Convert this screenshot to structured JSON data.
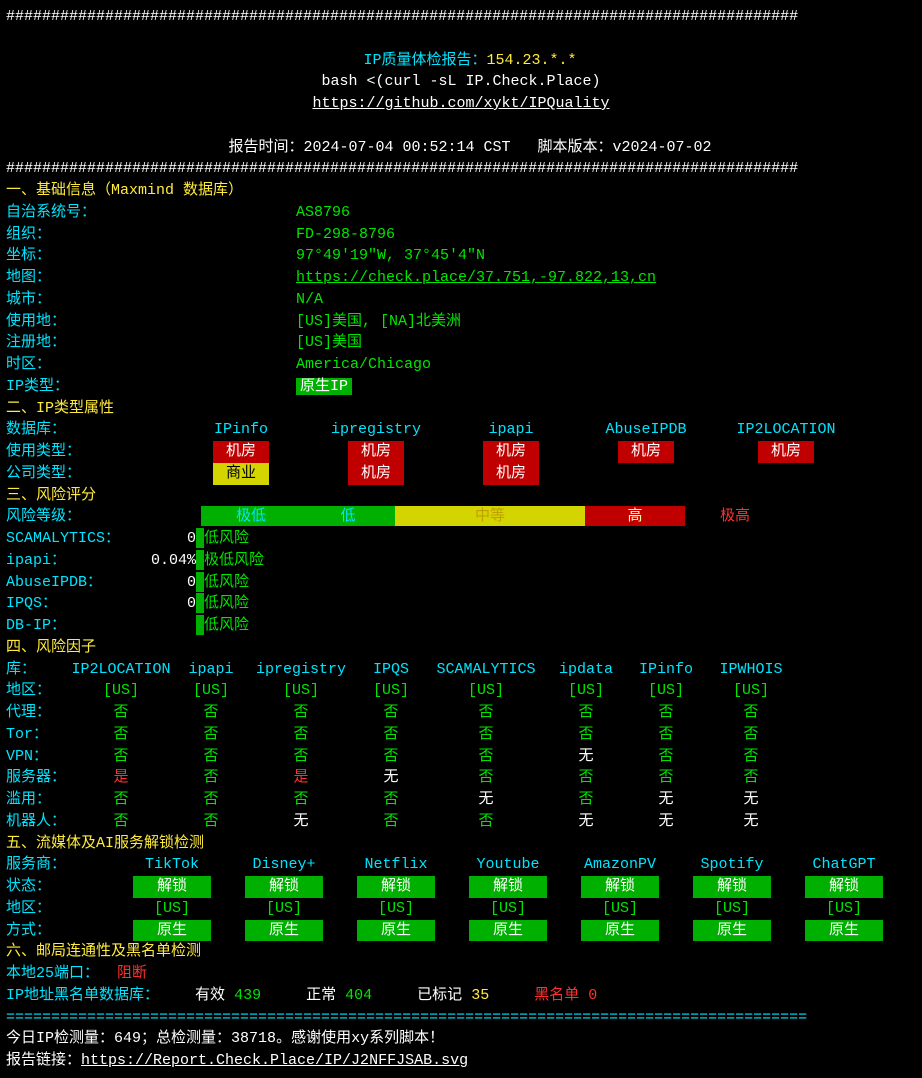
{
  "title": "IP质量体检报告：",
  "ip": "154.23.*.*",
  "cmd": "bash <(curl -sL IP.Check.Place)",
  "github": "https://github.com/xykt/IPQuality",
  "report_time_label": "报告时间：",
  "report_time": "2024-07-04 00:52:14 CST",
  "script_ver_label": "脚本版本：",
  "script_ver": "v2024-07-02",
  "sec1": "一、基础信息（Maxmind 数据库）",
  "basic": {
    "asn_l": "自治系统号：",
    "asn": "AS8796",
    "org_l": "组织：",
    "org": "FD-298-8796",
    "coord_l": "坐标：",
    "coord": "97°49′19″W, 37°45′4″N",
    "map_l": "地图：",
    "map": "https://check.place/37.751,-97.822,13,cn",
    "city_l": "城市：",
    "city": "N/A",
    "use_l": "使用地：",
    "use": "[US]美国, [NA]北美洲",
    "reg_l": "注册地：",
    "reg": "[US]美国",
    "tz_l": "时区：",
    "tz": "America/Chicago",
    "iptype_l": "IP类型：",
    "iptype": "原生IP"
  },
  "sec2": "二、IP类型属性",
  "db_l": "数据库：",
  "db_cols": [
    "IPinfo",
    "ipregistry",
    "ipapi",
    "AbuseIPDB",
    "IP2LOCATION"
  ],
  "usage_l": "使用类型：",
  "usage_vals": [
    "机房",
    "机房",
    "机房",
    "机房",
    "机房"
  ],
  "company_l": "公司类型：",
  "company_vals": [
    "商业",
    "机房",
    "机房",
    "",
    ""
  ],
  "sec3": "三、风险评分",
  "risk_level_l": "风险等级：",
  "risk_levels": [
    "极低",
    "低",
    "中等",
    "高",
    "极高"
  ],
  "risk_rows": [
    {
      "name": "SCAMALYTICS：",
      "score": "0",
      "label": "低风险"
    },
    {
      "name": "ipapi：",
      "score": "0.04%",
      "label": "极低风险"
    },
    {
      "name": "AbuseIPDB：",
      "score": "0",
      "label": "低风险"
    },
    {
      "name": "IPQS：",
      "score": "0",
      "label": "低风险"
    },
    {
      "name": "DB-IP：",
      "score": "",
      "label": "低风险"
    }
  ],
  "sec4": "四、风险因子",
  "factor_lib_l": "库：",
  "factor_cols": [
    "IP2LOCATION",
    "ipapi",
    "ipregistry",
    "IPQS",
    "SCAMALYTICS",
    "ipdata",
    "IPinfo",
    "IPWHOIS"
  ],
  "factor_rows": [
    {
      "l": "地区：",
      "color": "green",
      "v": [
        "[US]",
        "[US]",
        "[US]",
        "[US]",
        "[US]",
        "[US]",
        "[US]",
        "[US]"
      ]
    },
    {
      "l": "代理：",
      "v": [
        "否",
        "否",
        "否",
        "否",
        "否",
        "否",
        "否",
        "否"
      ],
      "colors": [
        "g",
        "g",
        "g",
        "g",
        "g",
        "g",
        "g",
        "g"
      ]
    },
    {
      "l": "Tor：",
      "v": [
        "否",
        "否",
        "否",
        "否",
        "否",
        "否",
        "否",
        "否"
      ],
      "colors": [
        "g",
        "g",
        "g",
        "g",
        "g",
        "g",
        "g",
        "g"
      ]
    },
    {
      "l": "VPN：",
      "v": [
        "否",
        "否",
        "否",
        "否",
        "否",
        "无",
        "否",
        "否"
      ],
      "colors": [
        "g",
        "g",
        "g",
        "g",
        "g",
        "w",
        "g",
        "g"
      ]
    },
    {
      "l": "服务器：",
      "v": [
        "是",
        "否",
        "是",
        "无",
        "否",
        "否",
        "否",
        "否"
      ],
      "colors": [
        "r",
        "g",
        "r",
        "w",
        "g",
        "g",
        "g",
        "g"
      ]
    },
    {
      "l": "滥用：",
      "v": [
        "否",
        "否",
        "否",
        "否",
        "无",
        "否",
        "无",
        "无"
      ],
      "colors": [
        "g",
        "g",
        "g",
        "g",
        "w",
        "g",
        "w",
        "w"
      ]
    },
    {
      "l": "机器人：",
      "v": [
        "否",
        "否",
        "无",
        "否",
        "否",
        "无",
        "无",
        "无"
      ],
      "colors": [
        "g",
        "g",
        "w",
        "g",
        "g",
        "w",
        "w",
        "w"
      ]
    }
  ],
  "sec5": "五、流媒体及AI服务解锁检测",
  "svc_l": "服务商：",
  "svc_cols": [
    "TikTok",
    "Disney+",
    "Netflix",
    "Youtube",
    "AmazonPV",
    "Spotify",
    "ChatGPT"
  ],
  "status_l": "状态：",
  "status_vals": [
    "解锁",
    "解锁",
    "解锁",
    "解锁",
    "解锁",
    "解锁",
    "解锁"
  ],
  "region_l": "地区：",
  "region_vals": [
    "[US]",
    "[US]",
    "[US]",
    "[US]",
    "[US]",
    "[US]",
    "[US]"
  ],
  "method_l": "方式：",
  "method_vals": [
    "原生",
    "原生",
    "原生",
    "原生",
    "原生",
    "原生",
    "原生"
  ],
  "sec6": "六、邮局连通性及黑名单检测",
  "port_l": "本地25端口：",
  "port_v": "阻断",
  "bl_l": "IP地址黑名单数据库：",
  "bl_valid_l": "有效",
  "bl_valid": "439",
  "bl_ok_l": "正常",
  "bl_ok": "404",
  "bl_marked_l": "已标记",
  "bl_marked": "35",
  "bl_black_l": "黑名单",
  "bl_black": "0",
  "footer1a": "今日IP检测量：",
  "footer1b": "649",
  "footer1c": "；总检测量：",
  "footer1d": "38718",
  "footer1e": "。感谢使用xy系列脚本！",
  "footer2_l": "报告链接：",
  "footer2_u": "https://Report.Check.Place/IP/J2NFFJSAB.svg"
}
